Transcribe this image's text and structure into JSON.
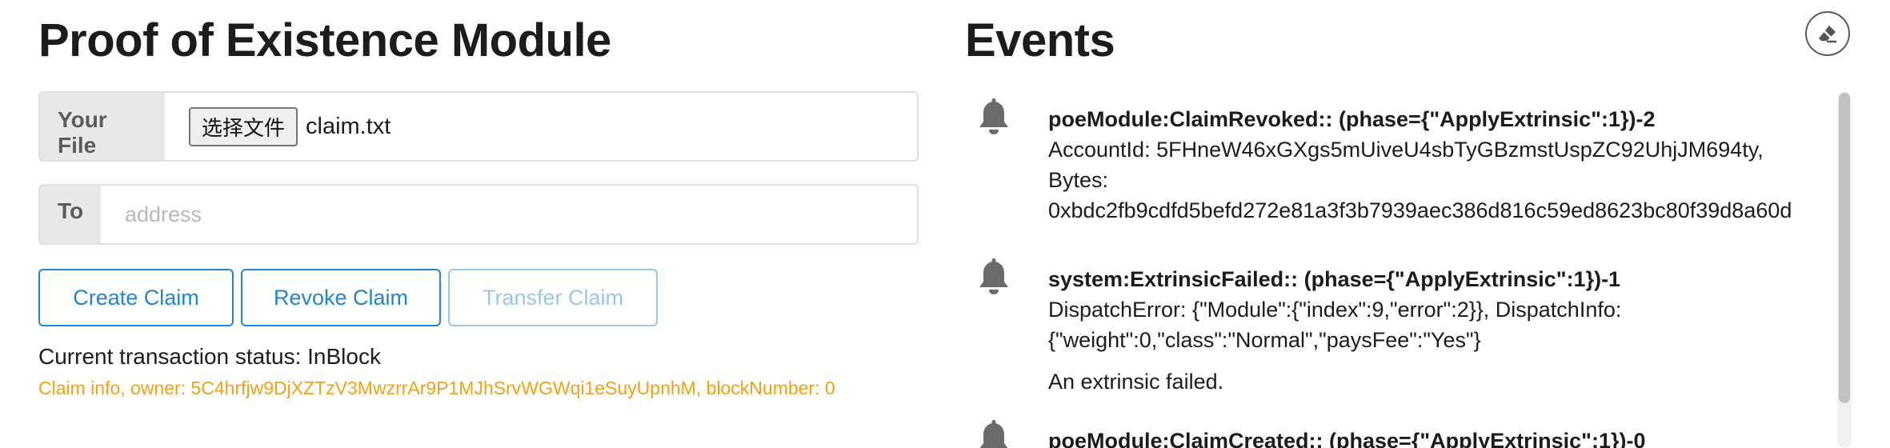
{
  "left": {
    "title": "Proof of Existence Module",
    "file": {
      "label": "Your File",
      "button_label": "选择文件",
      "filename": "claim.txt"
    },
    "to": {
      "label": "To",
      "placeholder": "address"
    },
    "buttons": {
      "create": "Create Claim",
      "revoke": "Revoke Claim",
      "transfer": "Transfer Claim"
    },
    "status": "Current transaction status: InBlock",
    "claim_info": "Claim info, owner: 5C4hrfjw9DjXZTzV3MwzrrAr9P1MJhSrvWGWqi1eSuyUpnhM, blockNumber: 0"
  },
  "events": {
    "title": "Events",
    "items": [
      {
        "header": "poeModule:ClaimRevoked:: (phase={\"ApplyExtrinsic\":1})-2",
        "lines": [
          "AccountId: 5FHneW46xGXgs5mUiveU4sbTyGBzmstUspZC92UhjJM694ty,",
          "Bytes:",
          "0xbdc2fb9cdfd5befd272e81a3f3b7939aec386d816c59ed8623bc80f39d8a60d"
        ],
        "description": ""
      },
      {
        "header": "system:ExtrinsicFailed:: (phase={\"ApplyExtrinsic\":1})-1",
        "lines": [
          "DispatchError: {\"Module\":{\"index\":9,\"error\":2}}, DispatchInfo:",
          "{\"weight\":0,\"class\":\"Normal\",\"paysFee\":\"Yes\"}"
        ],
        "description": "An extrinsic failed."
      },
      {
        "header": "poeModule:ClaimCreated:: (phase={\"ApplyExtrinsic\":1})-0",
        "lines": [],
        "description": ""
      }
    ]
  },
  "colors": {
    "primary": "#2185d0",
    "warning": "#f2a014",
    "label_bg": "#e8e8e8",
    "icon": "#6b6b6b"
  },
  "icons": {
    "event": "bell-icon",
    "clear": "eraser-icon"
  }
}
